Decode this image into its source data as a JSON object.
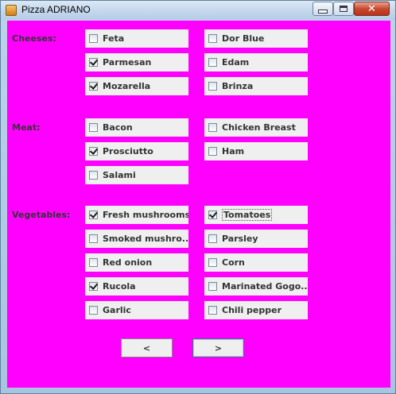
{
  "window": {
    "title": "Pizza  ADRIANO"
  },
  "sections": {
    "cheeses": "Cheeses:",
    "meat": "Meat:",
    "vegetables": "Vegetables:"
  },
  "cheeses": [
    {
      "label": "Feta",
      "checked": false
    },
    {
      "label": "Dor Blue",
      "checked": false
    },
    {
      "label": "Parmesan",
      "checked": true
    },
    {
      "label": "Edam",
      "checked": false
    },
    {
      "label": "Mozarella",
      "checked": true
    },
    {
      "label": "Brinza",
      "checked": false
    }
  ],
  "meat": [
    {
      "label": "Bacon",
      "checked": false
    },
    {
      "label": "Chicken Breast",
      "checked": false
    },
    {
      "label": "Prosciutto",
      "checked": true
    },
    {
      "label": "Ham",
      "checked": false
    },
    {
      "label": "Salami",
      "checked": false
    }
  ],
  "vegetables": [
    {
      "label": "Fresh mushrooms",
      "checked": true
    },
    {
      "label": "Tomatoes",
      "checked": true
    },
    {
      "label": "Smoked mushro...",
      "checked": false
    },
    {
      "label": "Parsley",
      "checked": false
    },
    {
      "label": "Red onion",
      "checked": false
    },
    {
      "label": "Corn",
      "checked": false
    },
    {
      "label": "Rucola",
      "checked": true
    },
    {
      "label": "Marinated Gogo...",
      "checked": false
    },
    {
      "label": "Garlic",
      "checked": false
    },
    {
      "label": "Chili pepper",
      "checked": false
    }
  ],
  "buttons": {
    "prev": "<",
    "next": ">"
  }
}
